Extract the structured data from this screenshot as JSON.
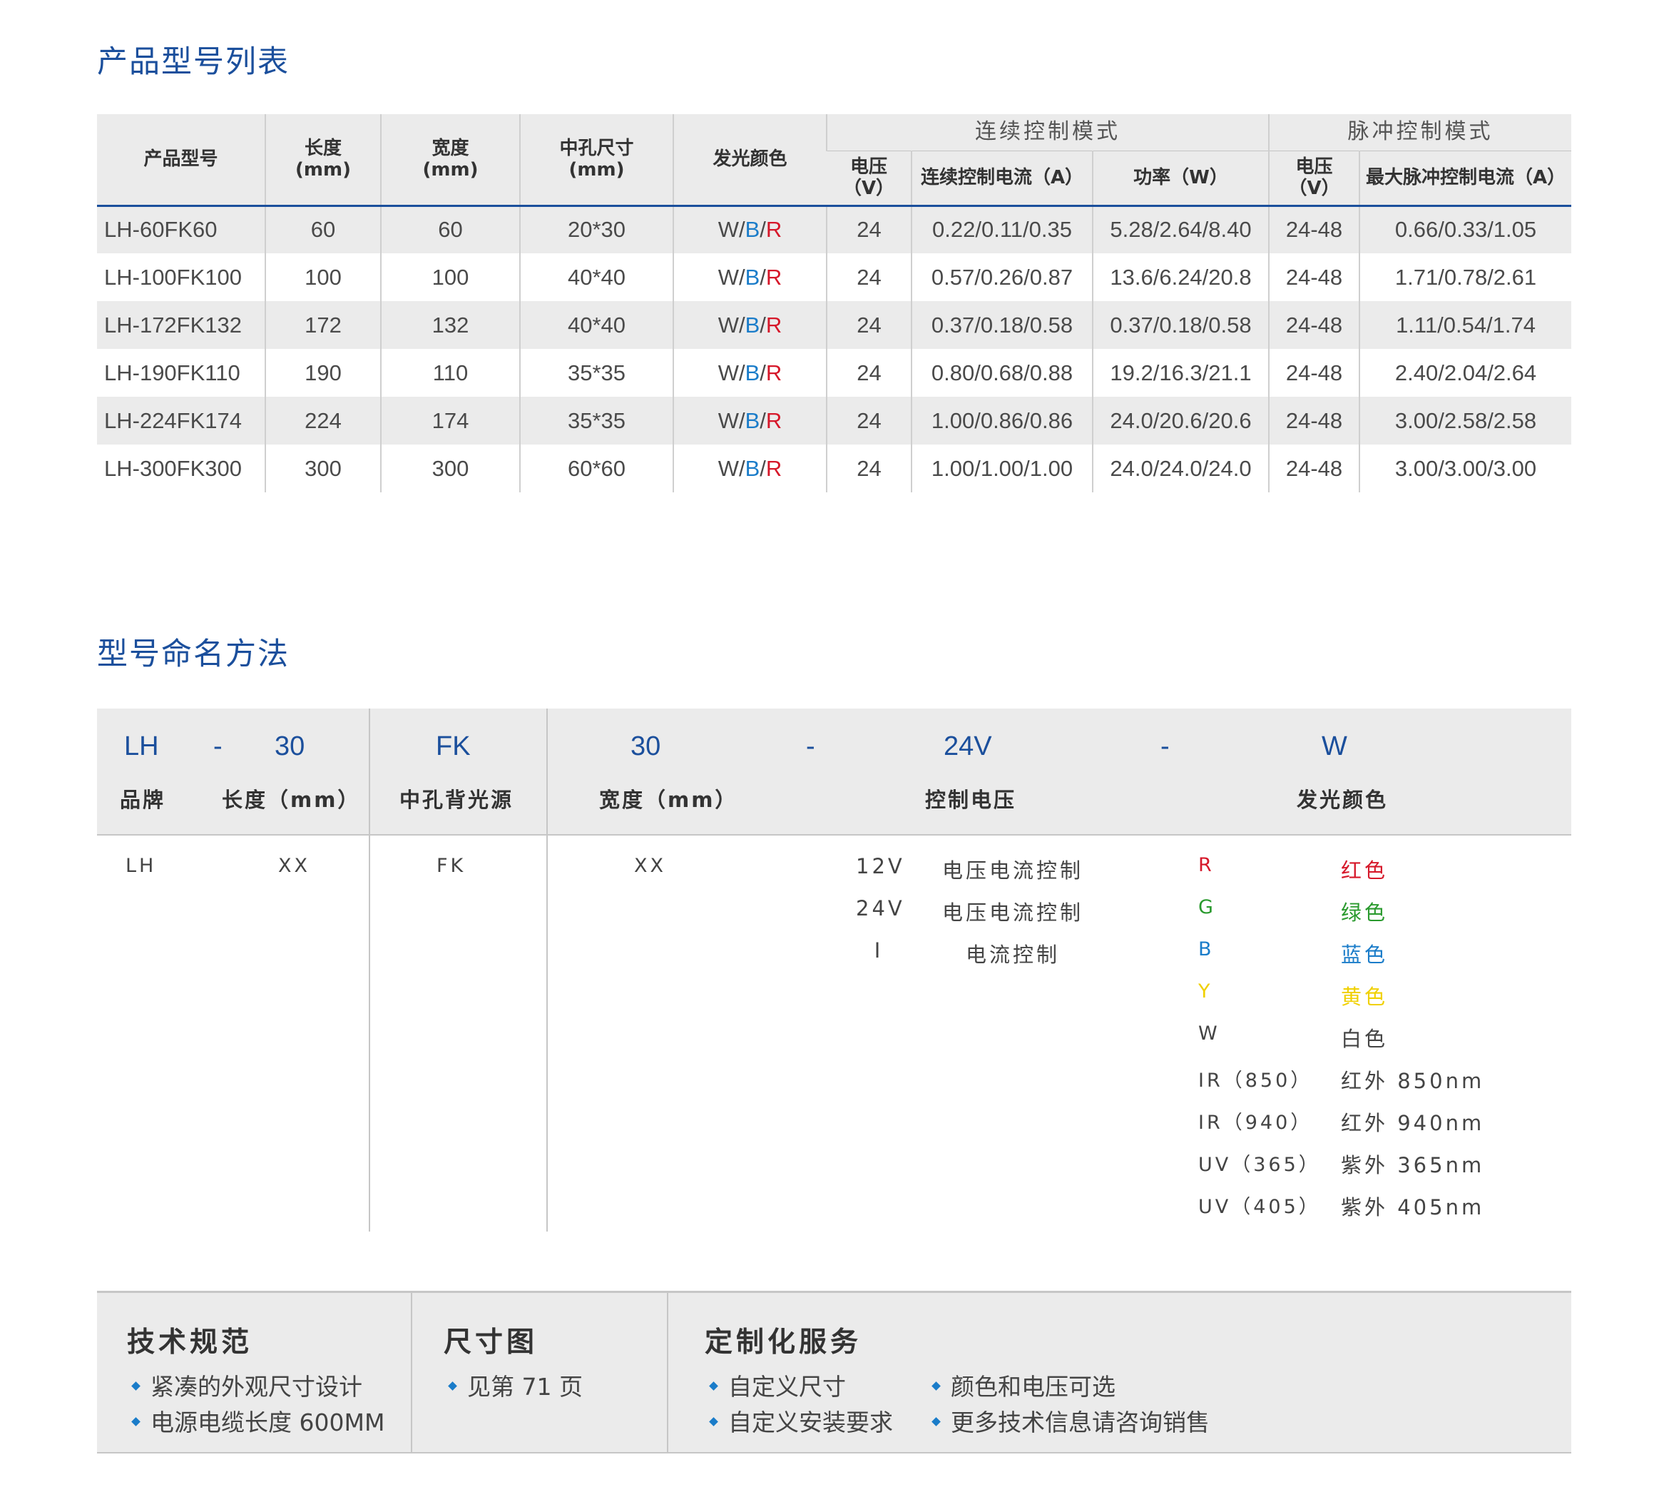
{
  "product_section": {
    "title": "产品型号列表",
    "headers": {
      "model": "产品型号",
      "length": "长度",
      "length_unit": "(mm)",
      "width": "宽度",
      "width_unit": "(mm)",
      "hole": "中孔尺寸",
      "hole_unit": "(mm)",
      "color": "发光颜色",
      "continuous_group": "连续控制模式",
      "pulse_group": "脉冲控制模式",
      "voltage": "电压",
      "voltage_unit": "（V）",
      "cont_current": "连续控制电流（A）",
      "power": "功率（W）",
      "pulse_voltage": "电压",
      "pulse_voltage_unit": "（V）",
      "max_pulse_current": "最大脉冲控制电流（A）"
    },
    "color_parts": {
      "w": "W",
      "sep": "/",
      "b": "B",
      "r": "R"
    },
    "rows": [
      {
        "model": "LH-60FK60",
        "length": "60",
        "width": "60",
        "hole": "20*30",
        "voltage": "24",
        "current": "0.22/0.11/0.35",
        "power": "5.28/2.64/8.40",
        "pulse_voltage": "24-48",
        "pulse_current": "0.66/0.33/1.05"
      },
      {
        "model": "LH-100FK100",
        "length": "100",
        "width": "100",
        "hole": "40*40",
        "voltage": "24",
        "current": "0.57/0.26/0.87",
        "power": "13.6/6.24/20.8",
        "pulse_voltage": "24-48",
        "pulse_current": "1.71/0.78/2.61"
      },
      {
        "model": "LH-172FK132",
        "length": "172",
        "width": "132",
        "hole": "40*40",
        "voltage": "24",
        "current": "0.37/0.18/0.58",
        "power": "0.37/0.18/0.58",
        "pulse_voltage": "24-48",
        "pulse_current": "1.11/0.54/1.74"
      },
      {
        "model": "LH-190FK110",
        "length": "190",
        "width": "110",
        "hole": "35*35",
        "voltage": "24",
        "current": "0.80/0.68/0.88",
        "power": "19.2/16.3/21.1",
        "pulse_voltage": "24-48",
        "pulse_current": "2.40/2.04/2.64"
      },
      {
        "model": "LH-224FK174",
        "length": "224",
        "width": "174",
        "hole": "35*35",
        "voltage": "24",
        "current": "1.00/0.86/0.86",
        "power": "24.0/20.6/20.6",
        "pulse_voltage": "24-48",
        "pulse_current": "3.00/2.58/2.58"
      },
      {
        "model": "LH-300FK300",
        "length": "300",
        "width": "300",
        "hole": "60*60",
        "voltage": "24",
        "current": "1.00/1.00/1.00",
        "power": "24.0/24.0/24.0",
        "pulse_voltage": "24-48",
        "pulse_current": "3.00/3.00/3.00"
      }
    ]
  },
  "naming_section": {
    "title": "型号命名方法",
    "codes": {
      "brand": "LH",
      "dash1": "-",
      "length": "30",
      "fk": "FK",
      "width": "30",
      "dash2": "-",
      "voltage": "24V",
      "dash3": "-",
      "color": "W"
    },
    "labels": {
      "brand": "品牌",
      "length": "长度（mm）",
      "fk": "中孔背光源",
      "width": "宽度（mm）",
      "voltage": "控制电压",
      "color": "发光颜色"
    },
    "values": {
      "brand": "LH",
      "length": "XX",
      "fk": "FK",
      "width": "XX"
    },
    "voltage_options": [
      {
        "code": "12V",
        "desc": "电压电流控制"
      },
      {
        "code": "24V",
        "desc": "电压电流控制"
      },
      {
        "code": "I",
        "desc": "电流控制"
      }
    ],
    "color_options": [
      {
        "code": "R",
        "desc": "红色",
        "color": "#d6182a"
      },
      {
        "code": "G",
        "desc": "绿色",
        "color": "#2a9a2e"
      },
      {
        "code": "B",
        "desc": "蓝色",
        "color": "#1a7cc9"
      },
      {
        "code": "Y",
        "desc": "黄色",
        "color": "#f0d000"
      },
      {
        "code": "W",
        "desc": "白色",
        "color": "#444444"
      },
      {
        "code": "IR（850）",
        "desc": "红外 850nm",
        "color": "#444444"
      },
      {
        "code": "IR（940）",
        "desc": "红外 940nm",
        "color": "#444444"
      },
      {
        "code": "UV（365）",
        "desc": "紫外 365nm",
        "color": "#444444"
      },
      {
        "code": "UV（405）",
        "desc": "紫外 405nm",
        "color": "#444444"
      }
    ]
  },
  "info_bar": {
    "tech": {
      "title": "技术规范",
      "items": [
        "紧凑的外观尺寸设计",
        "电源电缆长度 600MM"
      ]
    },
    "dims": {
      "title": "尺寸图",
      "items": [
        "见第 71 页"
      ]
    },
    "custom": {
      "title": "定制化服务",
      "items": [
        "自定义尺寸",
        "自定义安装要求",
        "颜色和电压可选",
        "更多技术信息请咨询销售"
      ]
    }
  },
  "colors": {
    "accent_blue": "#1b4f9c",
    "panel_gray": "#ebebeb",
    "red": "#d6182a",
    "blue": "#1a7cc9"
  }
}
